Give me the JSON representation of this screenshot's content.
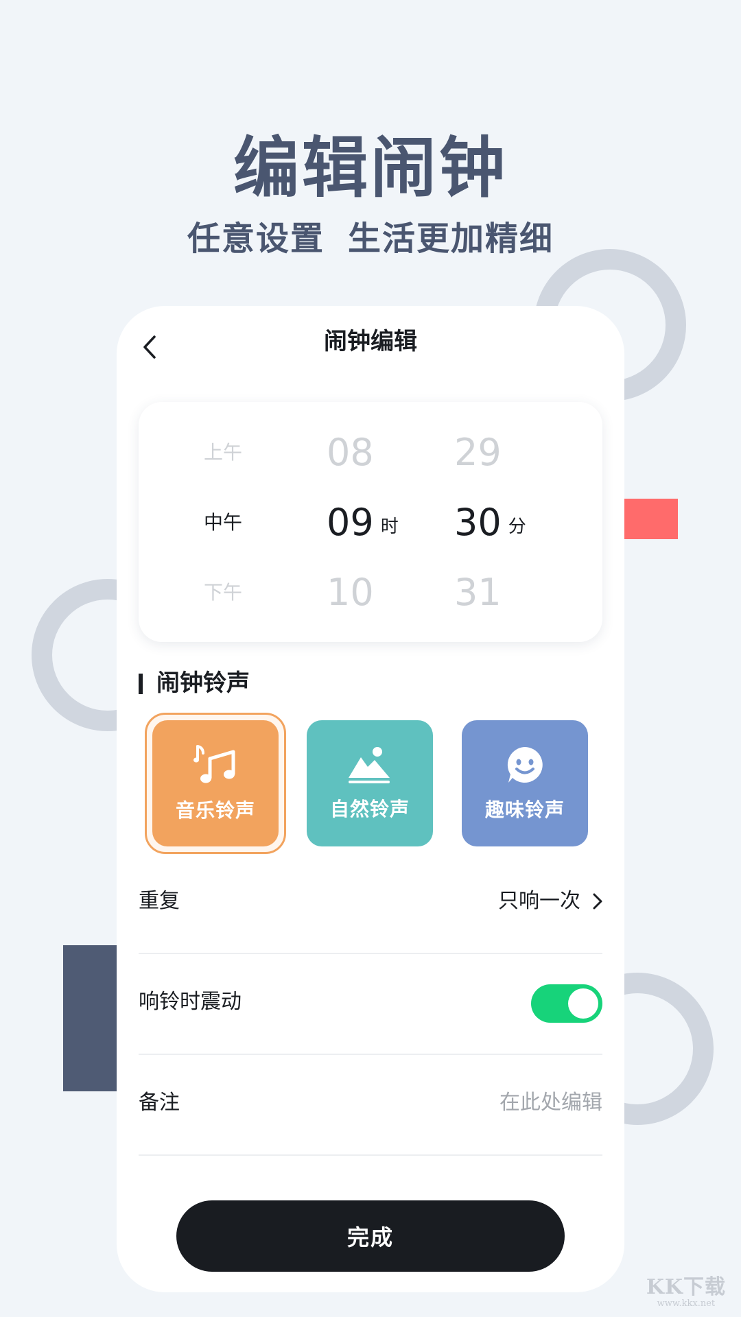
{
  "hero": {
    "title": "编辑闹钟",
    "subtitle_part1": "任意设置",
    "subtitle_part2": "生活更加精细"
  },
  "nav": {
    "title": "闹钟编辑",
    "back_icon": "chevron-left-icon"
  },
  "picker": {
    "ampm": {
      "prev": "上午",
      "selected": "中午",
      "next": "下午"
    },
    "hour": {
      "prev": "08",
      "selected": "09",
      "next": "10",
      "unit": "时"
    },
    "minute": {
      "prev": "29",
      "selected": "30",
      "next": "31",
      "unit": "分"
    }
  },
  "ringtones": {
    "section_title": "闹钟铃声",
    "items": [
      {
        "label": "音乐铃声",
        "icon": "music-note-icon",
        "color": "#f2a35e",
        "selected": true
      },
      {
        "label": "自然铃声",
        "icon": "mountain-icon",
        "color": "#5fc1bf",
        "selected": false
      },
      {
        "label": "趣味铃声",
        "icon": "smiley-icon",
        "color": "#7595d0",
        "selected": false
      }
    ]
  },
  "settings": {
    "repeat": {
      "label": "重复",
      "value": "只响一次"
    },
    "vibrate": {
      "label": "响铃时震动",
      "on": true
    },
    "note": {
      "label": "备注",
      "placeholder": "在此处编辑"
    }
  },
  "done_label": "完成",
  "watermark": {
    "main": "KK下载",
    "url": "www.kkx.net"
  },
  "colors": {
    "background": "#f1f5f9",
    "hero_text": "#4a5670",
    "toggle_on": "#17d37a",
    "button": "#191c21",
    "accent_red": "#ff6b6b",
    "accent_navy": "#4f5b74"
  }
}
